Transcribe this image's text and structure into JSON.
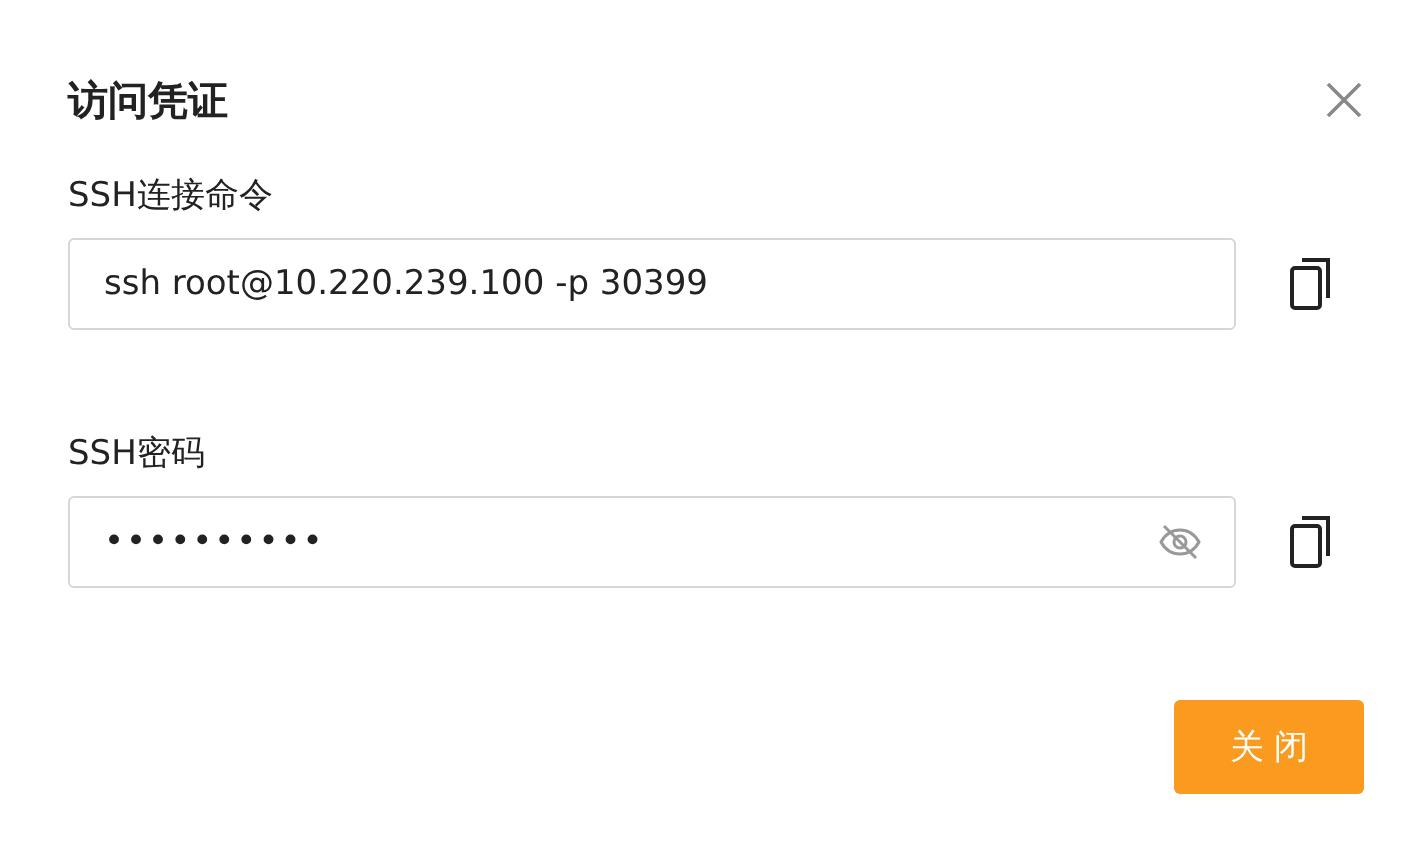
{
  "dialog": {
    "title": "访问凭证",
    "fields": [
      {
        "label": "SSH连接命令",
        "value": "ssh root@10.220.239.100 -p 30399",
        "kind": "text"
      },
      {
        "label": "SSH密码",
        "value": "••••••••••",
        "kind": "password"
      }
    ],
    "buttons": [
      {
        "label": "关 闭"
      }
    ]
  }
}
